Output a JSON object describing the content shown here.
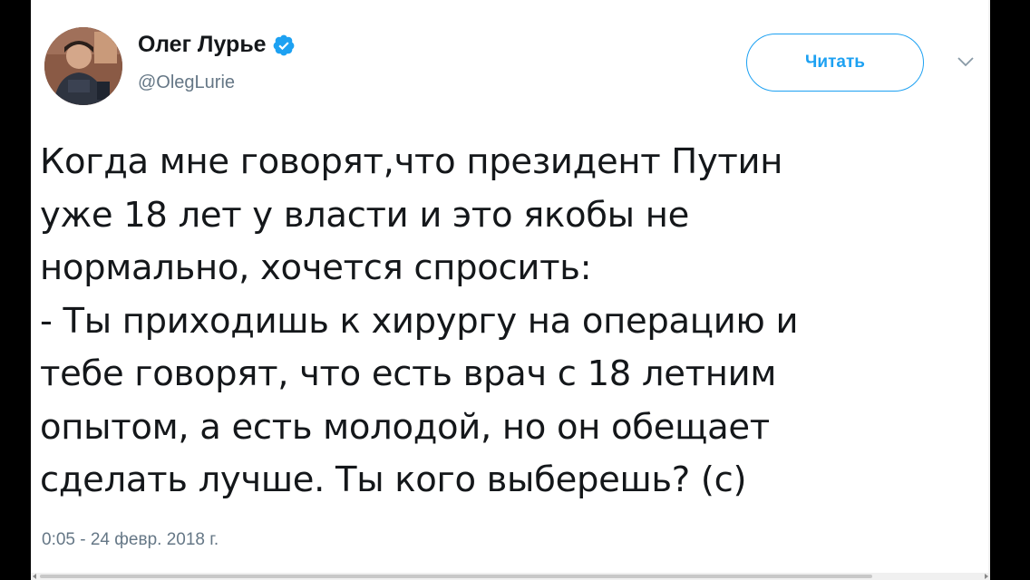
{
  "author": {
    "name": "Олег Лурье",
    "handle": "@OlegLurie",
    "verified": true
  },
  "actions": {
    "follow_label": "Читать",
    "menu_icon": "chevron-down-icon"
  },
  "tweet": {
    "text": "Когда мне говорят,что президент Путин\nуже 18 лет у власти и это якобы не\nнормально, хочется спросить:\n- Ты приходишь к хирургу на операцию и\nтебе говорят, что есть врач с 18 летним\nопытом, а есть молодой, но он обещает\nсделать лучше. Ты кого выберешь? (с)",
    "timestamp": "0:05 - 24 февр. 2018 г."
  },
  "colors": {
    "accent": "#1da1f2",
    "text": "#14171a",
    "secondary_text": "#657786"
  }
}
